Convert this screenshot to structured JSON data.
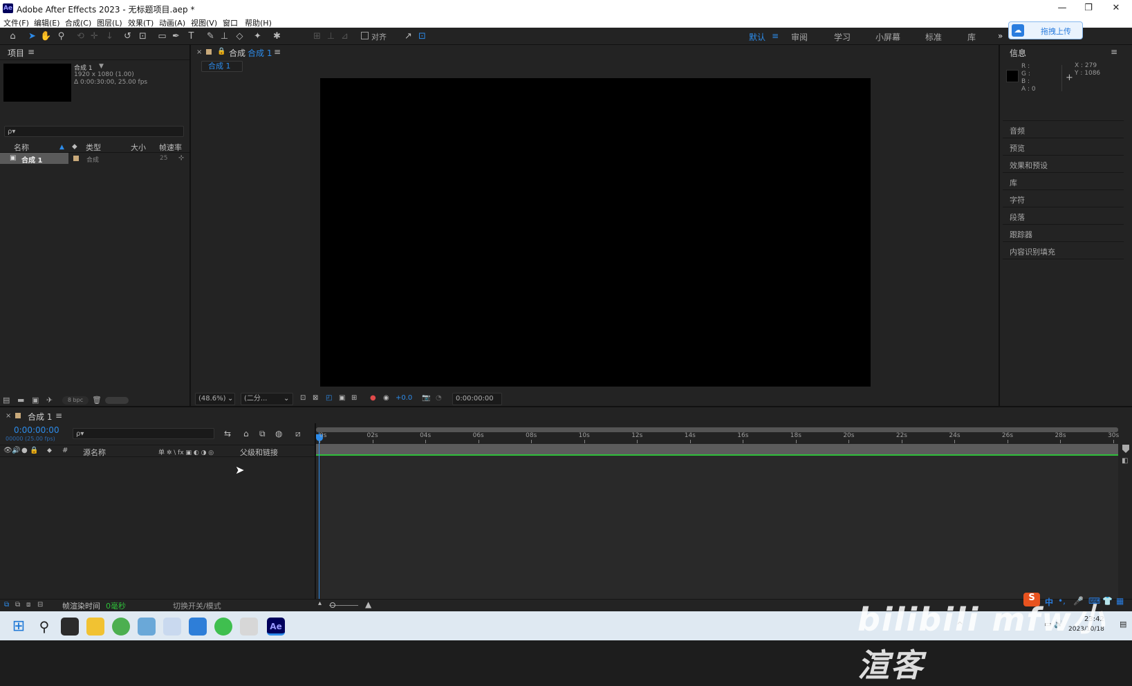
{
  "app": {
    "title": "Adobe After Effects 2023 - 无标题项目.aep *",
    "logo": "Ae",
    "window_controls": [
      "minimize-icon",
      "maximize-icon",
      "close-icon"
    ]
  },
  "menu": [
    "文件(F)",
    "编辑(E)",
    "合成(C)",
    "图层(L)",
    "效果(T)",
    "动画(A)",
    "视图(V)",
    "窗口",
    "帮助(H)"
  ],
  "toolbar": {
    "snap_label": "对齐",
    "workspaces": [
      "默认",
      "审阅",
      "学习",
      "小屏幕",
      "标准",
      "库"
    ],
    "active_workspace": "默认",
    "more": "»"
  },
  "upload": {
    "label": "拖拽上传"
  },
  "project": {
    "panel_title": "项目",
    "comp_name": "合成 1",
    "comp_res": "1920 x 1080 (1.00)",
    "comp_dur": "Δ 0:00:30:00, 25.00 fps",
    "search_placeholder": "ρ▾",
    "columns": [
      "名称",
      "类型",
      "大小",
      "帧速率"
    ],
    "rows": [
      {
        "name": "合成 1",
        "type": "合成",
        "size": "",
        "fps": "25"
      }
    ],
    "footer_bpc": "8 bpc"
  },
  "composition": {
    "tab_prefix": "合成",
    "tab_name": "合成 1",
    "subtab": "合成 1",
    "zoom": "(48.6%)",
    "resolution": "(二分...",
    "exposure": "+0.0",
    "timecode": "0:00:00:00"
  },
  "info": {
    "panel_title": "信息",
    "r": "R :",
    "g": "G :",
    "b": "B :",
    "a": "A : 0",
    "x": "X : 279",
    "y": "Y : 1086",
    "panels": [
      "音频",
      "预览",
      "效果和预设",
      "库",
      "字符",
      "段落",
      "跟踪器",
      "内容识别填充"
    ]
  },
  "timeline": {
    "tab_name": "合成 1",
    "timecode": "0:00:00:00",
    "frame_info": "00000 (25.00 fps)",
    "col_source": "源名称",
    "col_switches": "单 ✲ \\ fx ▣ ◐ ◑ ◎",
    "col_parent": "父级和链接",
    "ruler": [
      "0s",
      "02s",
      "04s",
      "06s",
      "08s",
      "10s",
      "12s",
      "14s",
      "16s",
      "18s",
      "20s",
      "22s",
      "24s",
      "26s",
      "28s",
      "30s"
    ],
    "footer_render": "帧渲染时间",
    "footer_render_value": "0毫秒",
    "footer_toggle": "切换开关/模式"
  },
  "tray": {
    "ime": "中",
    "time": "23:42",
    "date": "2023/10/18"
  },
  "watermark": "bilibili mfw小渲客"
}
